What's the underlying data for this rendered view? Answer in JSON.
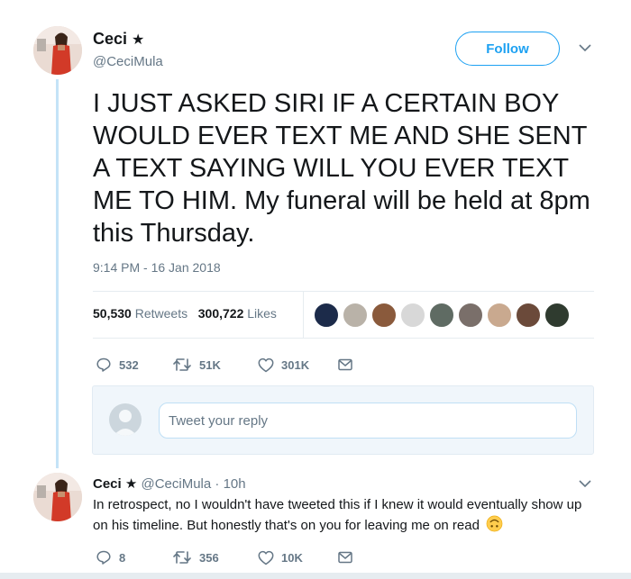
{
  "main_tweet": {
    "author": {
      "name": "Ceci",
      "badge": "★",
      "handle": "@CeciMula"
    },
    "follow_label": "Follow",
    "text": "I JUST ASKED SIRI IF A CERTAIN BOY WOULD EVER TEXT ME AND SHE SENT A TEXT SAYING WILL YOU EVER TEXT ME TO HIM. My funeral will be held at 8pm this Thursday.",
    "timestamp": "9:14 PM - 16 Jan 2018",
    "stats": {
      "retweets_count": "50,530",
      "retweets_label": "Retweets",
      "likes_count": "300,722",
      "likes_label": "Likes"
    },
    "liker_colors": [
      "#1c2b4a",
      "#b9b2a8",
      "#8a5a3c",
      "#d8d8d8",
      "#5f6b63",
      "#7a6f6a",
      "#c9a98f",
      "#6b4a3a",
      "#2f3b2f"
    ],
    "actions": {
      "replies": "532",
      "retweets": "51K",
      "likes": "301K"
    },
    "reply_placeholder": "Tweet your reply"
  },
  "reply_tweet": {
    "name": "Ceci",
    "badge": "★",
    "handle": "@CeciMula",
    "separator": "·",
    "time": "10h",
    "text": "In retrospect, no I wouldn't have tweeted this if I knew it would eventually show up on his timeline. But honestly that's on you for leaving me on read",
    "emoji_name": "upside-down-face-emoji",
    "actions": {
      "replies": "8",
      "retweets": "356",
      "likes": "10K"
    }
  },
  "colors": {
    "brand_blue": "#1da1f2",
    "thread_line": "#c4e3f7",
    "muted_text": "#657786"
  },
  "icons": [
    "reply-icon",
    "retweet-icon",
    "like-icon",
    "direct-message-icon",
    "chevron-down-icon"
  ]
}
